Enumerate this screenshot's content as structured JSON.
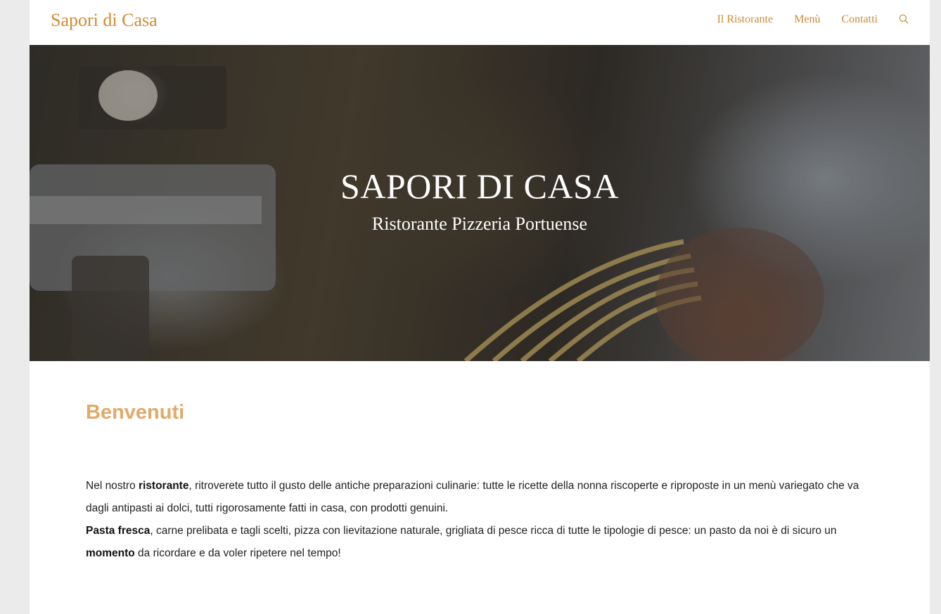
{
  "header": {
    "logo": "Sapori di Casa",
    "nav": [
      "Il Ristorante",
      "Menù",
      "Contatti"
    ],
    "search_icon": "search-icon"
  },
  "hero": {
    "title": "SAPORI DI CASA",
    "subtitle": "Ristorante Pizzeria Portuense"
  },
  "intro": {
    "heading": "Benvenuti",
    "p1": {
      "t1": "Nel nostro ",
      "b1": "ristorante",
      "t2": ", ritroverete tutto il gusto delle antiche preparazioni culinarie: tutte le ricette della nonna riscoperte e riproposte in un menù variegato che va dagli antipasti ai dolci, tutti rigorosamente fatti in casa, con prodotti genuini."
    },
    "p2": {
      "b1": "Pasta fresca",
      "t1": ", carne prelibata e tagli scelti, pizza con lievitazione naturale, grigliata di pesce ricca di tutte le tipologie di pesce: un pasto da noi è di sicuro un ",
      "b2": "momento",
      "t2": " da ricordare e da voler ripetere nel tempo!"
    }
  },
  "colors": {
    "accent": "#d38b2f",
    "heading": "#e3a96a",
    "background": "#ebebeb"
  }
}
